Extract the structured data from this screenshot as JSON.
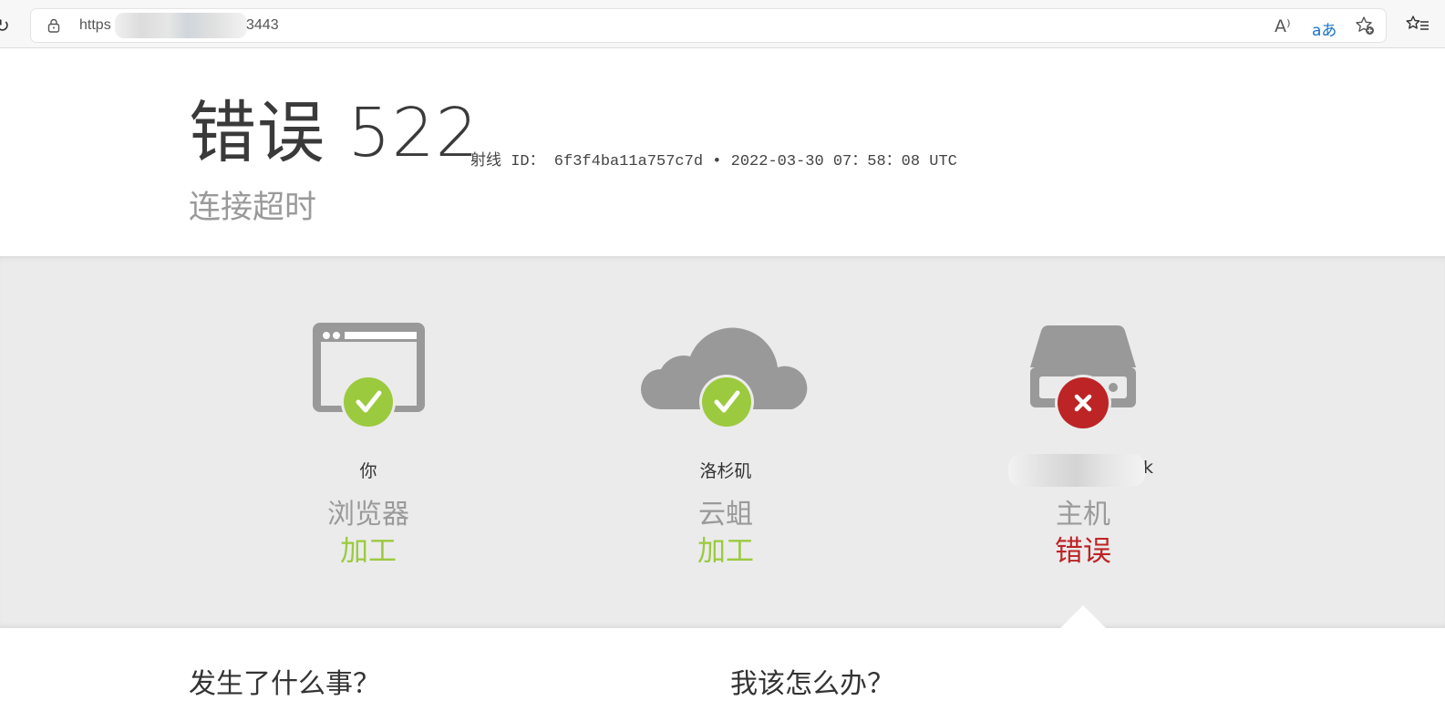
{
  "browser": {
    "url_prefix": "https",
    "url_suffix": "3443",
    "read_aloud_label": "A⁾",
    "translate_label": "aあ"
  },
  "error": {
    "title": "错误 522",
    "ray_id_text": "射线 ID： 6f3f4ba11a757c7d • 2022-03-30 07：58：08 UTC",
    "subtitle": "连接超时"
  },
  "status": {
    "browser": {
      "name": "你",
      "role": "浏览器",
      "state": "加工",
      "state_color": "#9bca3e",
      "icon": "browser-window-icon",
      "badge": "check-icon"
    },
    "cloud": {
      "name": "洛杉矶",
      "role": "云蛆",
      "state": "加工",
      "state_color": "#9bca3e",
      "icon": "cloud-icon",
      "badge": "check-icon"
    },
    "host": {
      "name_visible_suffix": "k",
      "role": "主机",
      "state": "错误",
      "state_color": "#bd2426",
      "icon": "server-drive-icon",
      "badge": "x-icon"
    }
  },
  "bottom": {
    "left_heading": "发生了什么事？",
    "right_heading": "我该怎么办？"
  }
}
